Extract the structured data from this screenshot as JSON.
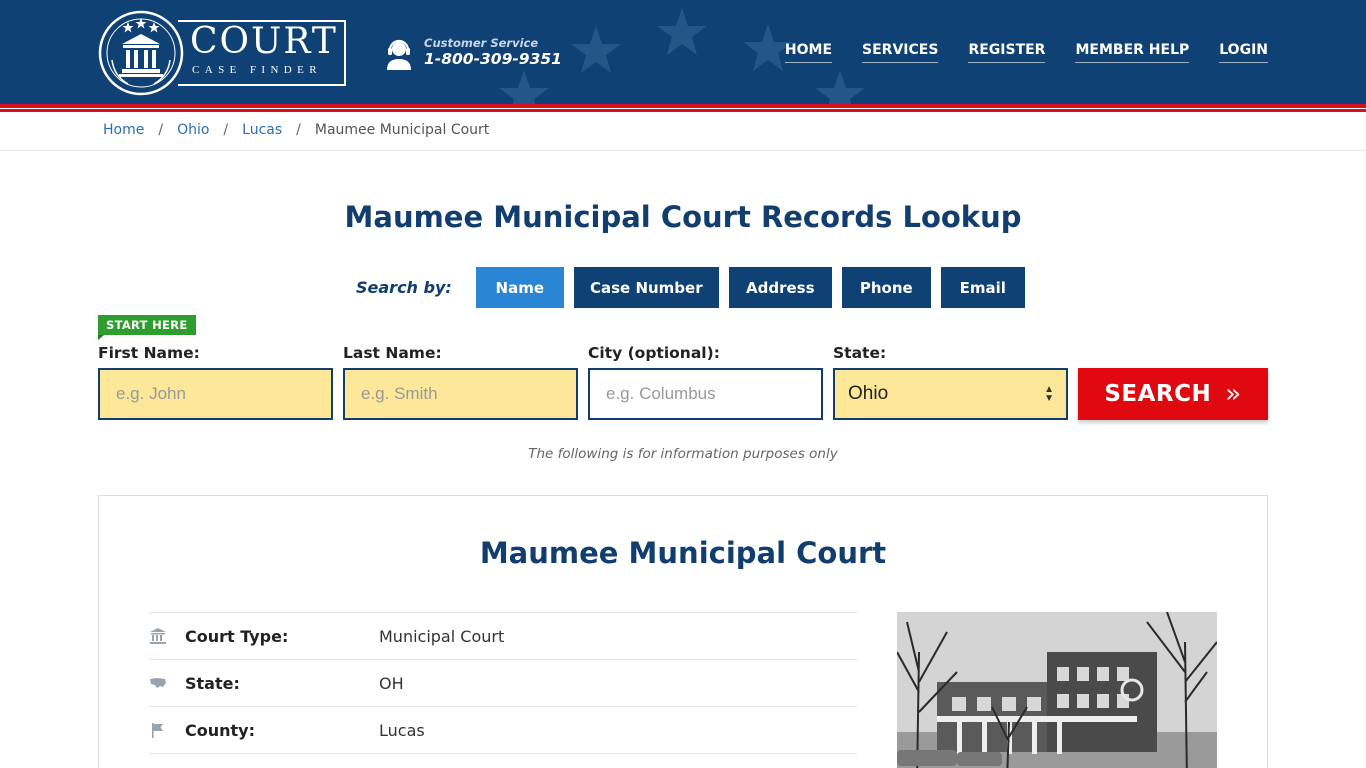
{
  "header": {
    "logo": {
      "title": "COURT",
      "subtitle": "CASE FINDER"
    },
    "customer_service": {
      "label": "Customer Service",
      "phone": "1-800-309-9351"
    },
    "nav": [
      {
        "label": "HOME"
      },
      {
        "label": "SERVICES"
      },
      {
        "label": "REGISTER"
      },
      {
        "label": "MEMBER HELP"
      },
      {
        "label": "LOGIN"
      }
    ],
    "colors": {
      "primary": "#0f4174",
      "accent_red": "#d8101e"
    }
  },
  "breadcrumb": {
    "items": [
      {
        "label": "Home"
      },
      {
        "label": "Ohio"
      },
      {
        "label": "Lucas"
      }
    ],
    "current": "Maumee Municipal Court",
    "separator": "/"
  },
  "page_title": "Maumee Municipal Court Records Lookup",
  "search": {
    "search_by_label": "Search by:",
    "tabs": [
      {
        "label": "Name",
        "active": true
      },
      {
        "label": "Case Number",
        "active": false
      },
      {
        "label": "Address",
        "active": false
      },
      {
        "label": "Phone",
        "active": false
      },
      {
        "label": "Email",
        "active": false
      }
    ],
    "start_here_badge": "START HERE",
    "fields": {
      "first_name": {
        "label": "First Name:",
        "placeholder": "e.g. John"
      },
      "last_name": {
        "label": "Last Name:",
        "placeholder": "e.g. Smith"
      },
      "city": {
        "label": "City (optional):",
        "placeholder": "e.g.  Columbus"
      },
      "state": {
        "label": "State:",
        "value": "Ohio"
      }
    },
    "button_label": "SEARCH",
    "button_icon": "double-chevron-right-icon",
    "disclaimer": "The following is for information purposes only"
  },
  "court": {
    "title": "Maumee Municipal Court",
    "details": [
      {
        "key": "Court Type:",
        "value": "Municipal Court",
        "icon": "courthouse-icon"
      },
      {
        "key": "State:",
        "value": "OH",
        "icon": "us-map-icon"
      },
      {
        "key": "County:",
        "value": "Lucas",
        "icon": "flag-icon"
      }
    ]
  }
}
